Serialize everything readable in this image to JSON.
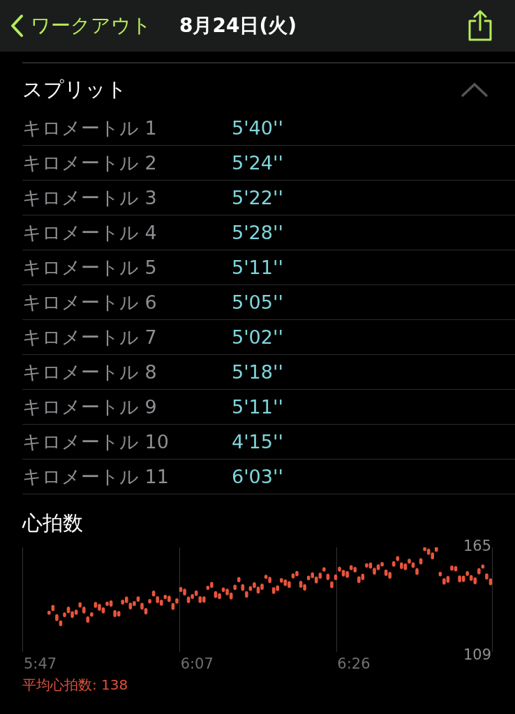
{
  "nav": {
    "back_label": "ワークアウト",
    "title": "8月24日(火)"
  },
  "splits": {
    "title": "スプリット",
    "expanded": true,
    "rows": [
      {
        "label": "キロメートル 1",
        "pace": "5'40''"
      },
      {
        "label": "キロメートル 2",
        "pace": "5'24''"
      },
      {
        "label": "キロメートル 3",
        "pace": "5'22''"
      },
      {
        "label": "キロメートル 4",
        "pace": "5'28''"
      },
      {
        "label": "キロメートル 5",
        "pace": "5'11''"
      },
      {
        "label": "キロメートル 6",
        "pace": "5'05''"
      },
      {
        "label": "キロメートル 7",
        "pace": "5'02''"
      },
      {
        "label": "キロメートル 8",
        "pace": "5'18''"
      },
      {
        "label": "キロメートル 9",
        "pace": "5'11''"
      },
      {
        "label": "キロメートル 10",
        "pace": "4'15''"
      },
      {
        "label": "キロメートル 11",
        "pace": "6'03''"
      }
    ]
  },
  "heart_rate": {
    "title": "心拍数",
    "y_labels": [
      "165",
      "109"
    ],
    "x_labels": [
      "5:47",
      "6:07",
      "6:26"
    ],
    "average": "平均心拍数: 138"
  }
}
